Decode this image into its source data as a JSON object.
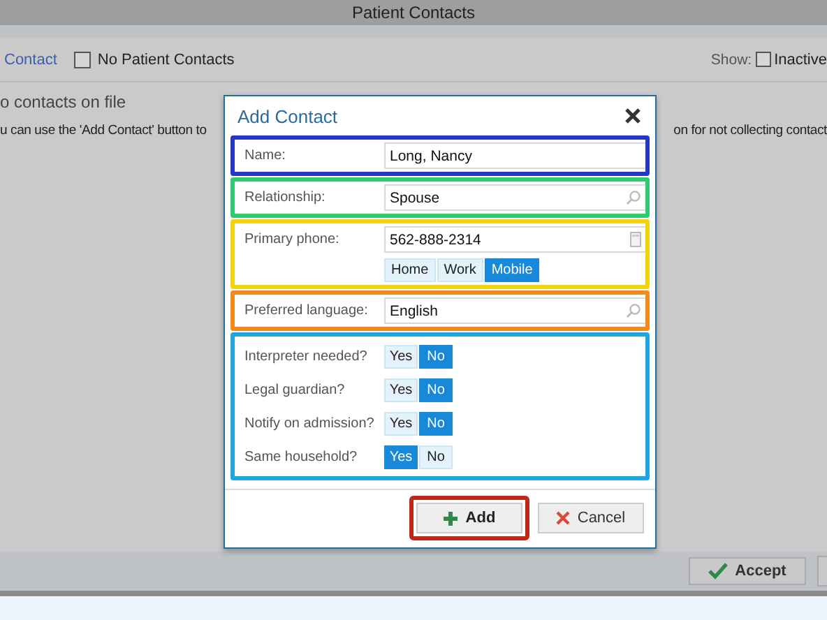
{
  "window": {
    "title": "Patient Contacts"
  },
  "toolbar": {
    "add_link": "Contact",
    "no_contacts": {
      "label": "No Patient Contacts",
      "checked": false
    },
    "show_label": "Show:",
    "inactive": {
      "label": "Inactive",
      "checked": false
    }
  },
  "message": {
    "heading": "o contacts on file",
    "text_left": "u can use the 'Add Contact' button to",
    "text_right": "on for not collecting contact"
  },
  "footer": {
    "buttons": [
      {
        "kind": "accept",
        "label": "Accept"
      }
    ]
  },
  "dialog": {
    "title": "Add Contact",
    "sections": [
      {
        "color": "#2636c6",
        "fields": [
          {
            "kind": "text",
            "label": "Name:",
            "value": "Long, Nancy"
          }
        ]
      },
      {
        "color": "#2ecc71",
        "fields": [
          {
            "kind": "lookup",
            "label": "Relationship:",
            "value": "Spouse"
          }
        ]
      },
      {
        "color": "#f2d40c",
        "fields": [
          {
            "kind": "phone",
            "label": "Primary phone:",
            "value": "562-888-2314",
            "options": [
              {
                "label": "Home",
                "selected": false
              },
              {
                "label": "Work",
                "selected": false
              },
              {
                "label": "Mobile",
                "selected": true
              }
            ]
          }
        ]
      },
      {
        "color": "#f28a1e",
        "fields": [
          {
            "kind": "lookup",
            "label": "Preferred language:",
            "value": "English"
          }
        ]
      },
      {
        "color": "#1ea6e0",
        "fields": [
          {
            "kind": "toggle",
            "label": "Interpreter needed?",
            "options": [
              {
                "label": "Yes",
                "selected": false
              },
              {
                "label": "No",
                "selected": true
              }
            ]
          },
          {
            "kind": "toggle",
            "label": "Legal guardian?",
            "options": [
              {
                "label": "Yes",
                "selected": false
              },
              {
                "label": "No",
                "selected": true
              }
            ]
          },
          {
            "kind": "toggle",
            "label": "Notify on admission?",
            "options": [
              {
                "label": "Yes",
                "selected": false
              },
              {
                "label": "No",
                "selected": true
              }
            ]
          },
          {
            "kind": "toggle",
            "label": "Same household?",
            "options": [
              {
                "label": "Yes",
                "selected": true
              },
              {
                "label": "No",
                "selected": false
              }
            ]
          }
        ]
      }
    ],
    "actions": {
      "color": "#c0271b",
      "buttons": [
        {
          "kind": "add",
          "label": "Add"
        },
        {
          "kind": "cancel",
          "label": "Cancel"
        }
      ]
    }
  }
}
